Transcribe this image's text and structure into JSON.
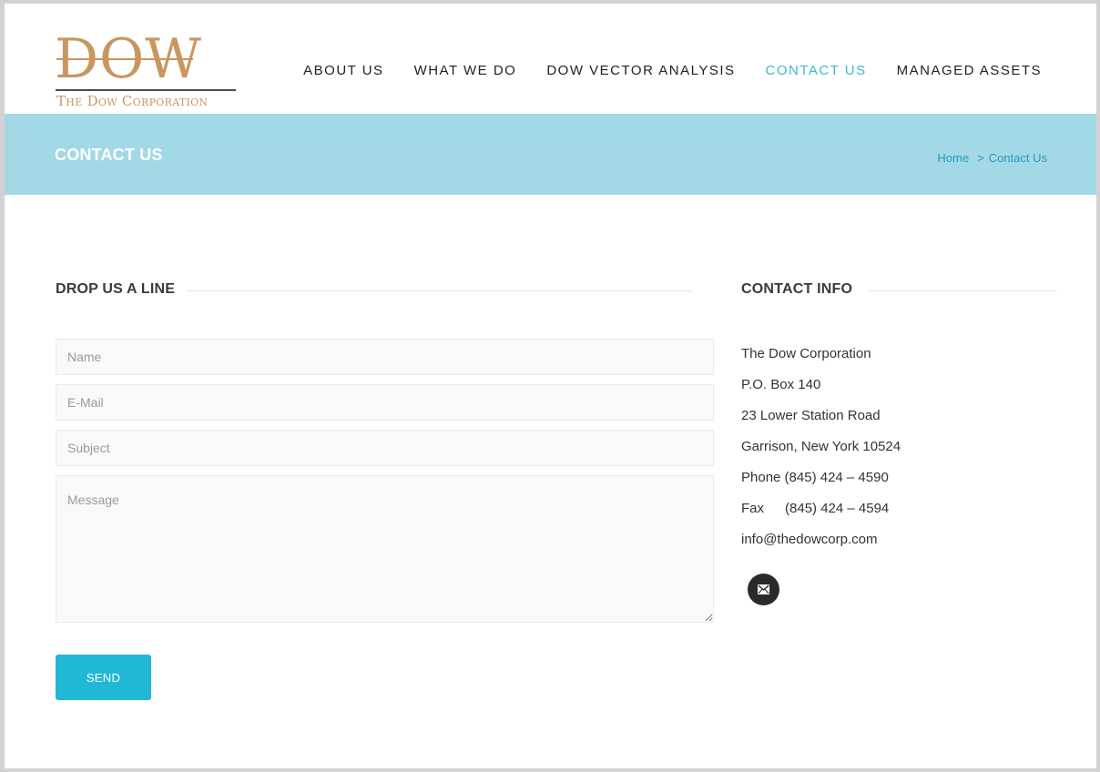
{
  "logo": {
    "word": "DOW",
    "subtitle": "The Dow Corporation",
    "color": "#c9965f"
  },
  "nav": {
    "items": [
      {
        "label": "ABOUT US"
      },
      {
        "label": "WHAT WE DO"
      },
      {
        "label": "DOW VECTOR ANALYSIS"
      },
      {
        "label": "CONTACT US",
        "active": true
      },
      {
        "label": "MANAGED ASSETS"
      }
    ],
    "active_color": "#3eb8cf"
  },
  "titlebar": {
    "title": "CONTACT US",
    "breadcrumb": {
      "home": "Home",
      "separator": ">",
      "current": "Contact Us"
    },
    "background": "#a3d8e6"
  },
  "form": {
    "heading": "DROP US A LINE",
    "name_placeholder": "Name",
    "email_placeholder": "E-Mail",
    "subject_placeholder": "Subject",
    "message_placeholder": "Message",
    "send_label": "SEND",
    "send_color": "#21b8d5"
  },
  "contact": {
    "heading": "CONTACT INFO",
    "company": "The Dow Corporation",
    "po_box": "P.O. Box 140",
    "street": "23 Lower Station Road",
    "city": "Garrison, New York 10524",
    "phone_label": "Phone",
    "phone": "(845) 424 – 4590",
    "fax_label": "Fax",
    "fax": "(845) 424 – 4594",
    "email": "info@thedowcorp.com",
    "social_icon": "envelope-icon"
  }
}
